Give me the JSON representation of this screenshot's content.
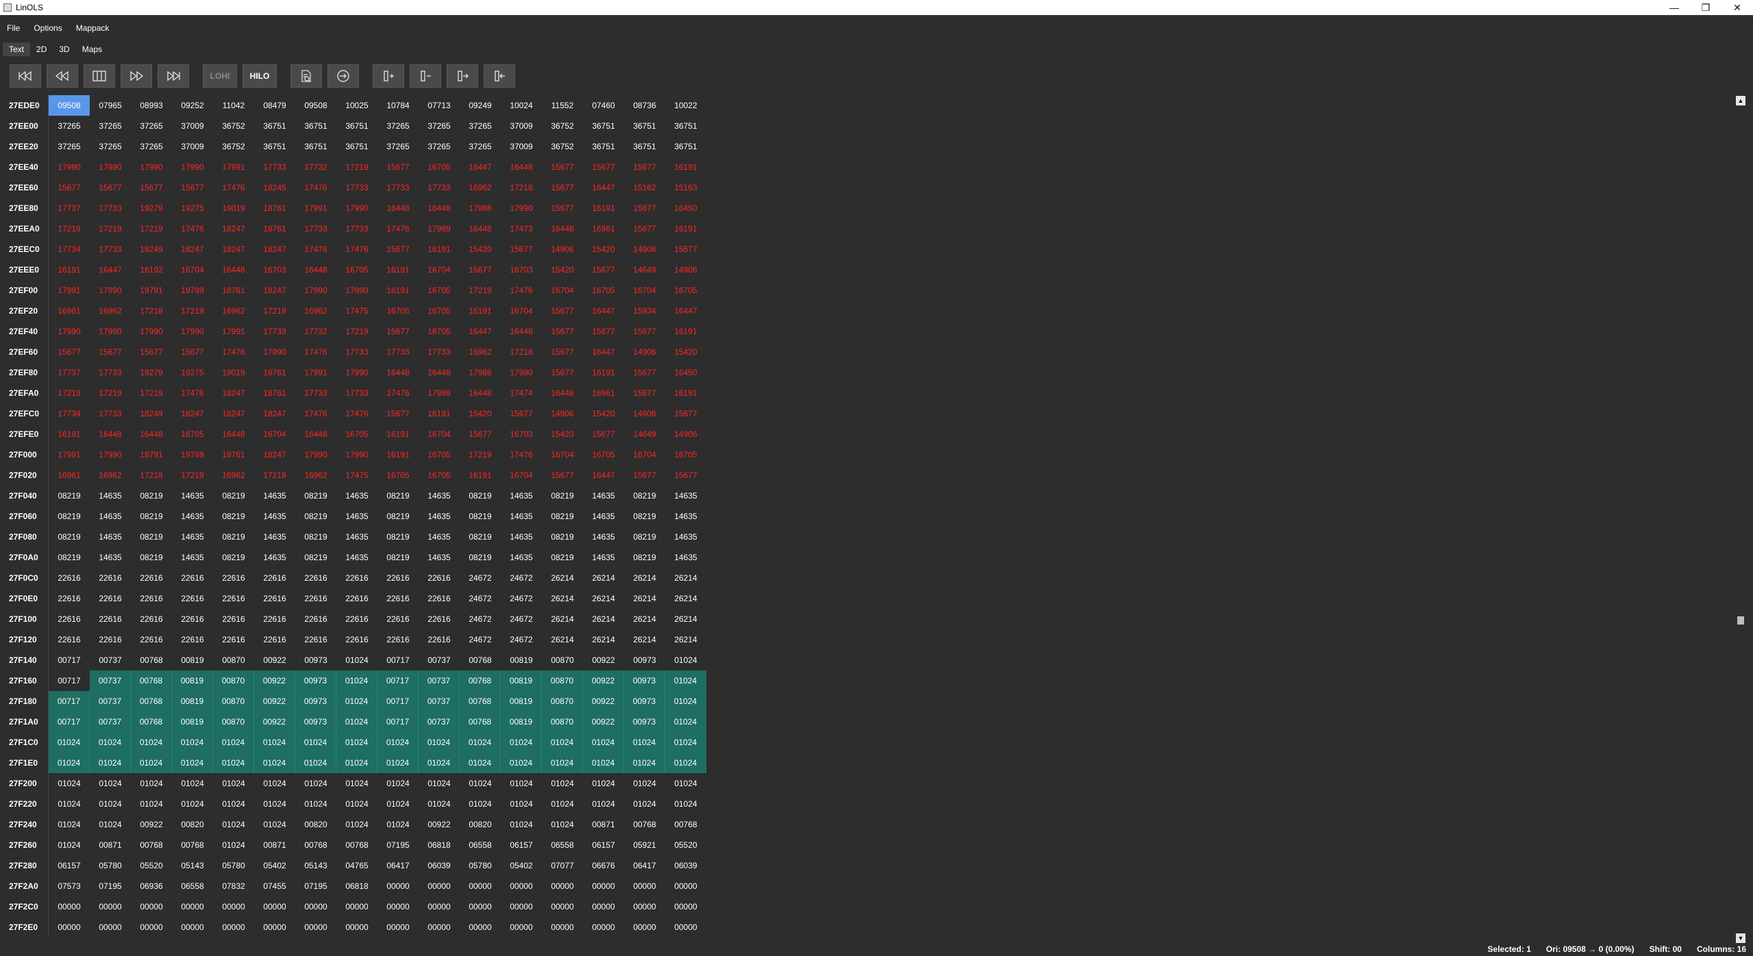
{
  "window": {
    "title": "LinOLS",
    "minimize": "—",
    "maximize": "❐",
    "close": "✕"
  },
  "menu": [
    "File",
    "Options",
    "Mappack"
  ],
  "view_tabs": [
    "Text",
    "2D",
    "3D",
    "Maps"
  ],
  "active_view": "Text",
  "toolbar": {
    "buttons": [
      {
        "name": "skip-first-button",
        "icon": "skip-first-icon"
      },
      {
        "name": "rewind-button",
        "icon": "rewind-icon"
      },
      {
        "name": "columns-button",
        "icon": "columns-icon"
      },
      {
        "name": "fast-forward-button",
        "icon": "fast-forward-icon"
      },
      {
        "name": "skip-last-button",
        "icon": "skip-last-icon"
      },
      {
        "name": "lohi-button",
        "label": "LOHI"
      },
      {
        "name": "hilo-button",
        "label": "HILO"
      },
      {
        "name": "find-document-button",
        "icon": "document-search-icon"
      },
      {
        "name": "goto-button",
        "icon": "goto-arrow-icon"
      },
      {
        "name": "add-column-right-button",
        "icon": "column-plus-icon"
      },
      {
        "name": "remove-column-button",
        "icon": "column-minus-icon"
      },
      {
        "name": "shift-right-button",
        "icon": "column-shift-right-icon"
      },
      {
        "name": "shift-left-button",
        "icon": "column-shift-left-icon"
      }
    ]
  },
  "hex_table": {
    "rows": [
      {
        "addr": "27EDE0",
        "vals": [
          "09508",
          "07965",
          "08993",
          "09252",
          "11042",
          "08479",
          "09508",
          "10025",
          "10784",
          "07713",
          "09249",
          "10024",
          "11552",
          "07460",
          "08736",
          "10022"
        ]
      },
      {
        "addr": "27EE00",
        "vals": [
          "37265",
          "37265",
          "37265",
          "37009",
          "36752",
          "36751",
          "36751",
          "36751",
          "37265",
          "37265",
          "37265",
          "37009",
          "36752",
          "36751",
          "36751",
          "36751"
        ]
      },
      {
        "addr": "27EE20",
        "vals": [
          "37265",
          "37265",
          "37265",
          "37009",
          "36752",
          "36751",
          "36751",
          "36751",
          "37265",
          "37265",
          "37265",
          "37009",
          "36752",
          "36751",
          "36751",
          "36751"
        ]
      },
      {
        "addr": "27EE40",
        "vals": [
          "17990",
          "17990",
          "17990",
          "17990",
          "17991",
          "17733",
          "17732",
          "17219",
          "15677",
          "16705",
          "16447",
          "16448",
          "15677",
          "15677",
          "15677",
          "16191"
        ]
      },
      {
        "addr": "27EE60",
        "vals": [
          "15677",
          "15677",
          "15677",
          "15677",
          "17476",
          "18245",
          "17476",
          "17733",
          "17733",
          "17733",
          "16962",
          "17218",
          "15677",
          "16447",
          "15162",
          "15163"
        ]
      },
      {
        "addr": "27EE80",
        "vals": [
          "17737",
          "17733",
          "19279",
          "19275",
          "19019",
          "18761",
          "17991",
          "17990",
          "16448",
          "16448",
          "17988",
          "17990",
          "15677",
          "16191",
          "15677",
          "16450"
        ]
      },
      {
        "addr": "27EEA0",
        "vals": [
          "17219",
          "17219",
          "17219",
          "17476",
          "18247",
          "18761",
          "17733",
          "17733",
          "17476",
          "17989",
          "16448",
          "17473",
          "16448",
          "16961",
          "15677",
          "16191"
        ]
      },
      {
        "addr": "27EEC0",
        "vals": [
          "17734",
          "17733",
          "18249",
          "18247",
          "18247",
          "18247",
          "17476",
          "17476",
          "15677",
          "16191",
          "15420",
          "15677",
          "14906",
          "15420",
          "14906",
          "15677"
        ]
      },
      {
        "addr": "27EEE0",
        "vals": [
          "16191",
          "16447",
          "16192",
          "16704",
          "16448",
          "16703",
          "16448",
          "16705",
          "16191",
          "16704",
          "15677",
          "16703",
          "15420",
          "15677",
          "14649",
          "14906"
        ]
      },
      {
        "addr": "27EF00",
        "vals": [
          "17991",
          "17990",
          "19791",
          "19789",
          "18761",
          "18247",
          "17990",
          "17990",
          "16191",
          "16705",
          "17219",
          "17476",
          "16704",
          "16705",
          "16704",
          "16705"
        ]
      },
      {
        "addr": "27EF20",
        "vals": [
          "16961",
          "16962",
          "17218",
          "17219",
          "16962",
          "17219",
          "16962",
          "17475",
          "16705",
          "16705",
          "16191",
          "16704",
          "15677",
          "16447",
          "15934",
          "16447"
        ]
      },
      {
        "addr": "27EF40",
        "vals": [
          "17990",
          "17990",
          "17990",
          "17990",
          "17991",
          "17733",
          "17732",
          "17219",
          "15677",
          "16705",
          "16447",
          "16448",
          "15677",
          "15677",
          "15677",
          "16191"
        ]
      },
      {
        "addr": "27EF60",
        "vals": [
          "15677",
          "15677",
          "15677",
          "15677",
          "17476",
          "17990",
          "17476",
          "17733",
          "17733",
          "17733",
          "16962",
          "17218",
          "15677",
          "16447",
          "14906",
          "15420"
        ]
      },
      {
        "addr": "27EF80",
        "vals": [
          "17737",
          "17733",
          "19279",
          "19275",
          "19019",
          "18761",
          "17991",
          "17990",
          "16448",
          "16448",
          "17988",
          "17990",
          "15677",
          "16191",
          "15677",
          "16450"
        ]
      },
      {
        "addr": "27EFA0",
        "vals": [
          "17219",
          "17219",
          "17219",
          "17476",
          "18247",
          "18761",
          "17733",
          "17733",
          "17476",
          "17989",
          "16448",
          "17474",
          "16448",
          "16961",
          "15677",
          "16191"
        ]
      },
      {
        "addr": "27EFC0",
        "vals": [
          "17734",
          "17733",
          "18249",
          "18247",
          "18247",
          "18247",
          "17476",
          "17476",
          "15677",
          "16191",
          "15420",
          "15677",
          "14906",
          "15420",
          "14906",
          "15677"
        ]
      },
      {
        "addr": "27EFE0",
        "vals": [
          "16191",
          "16448",
          "16448",
          "16705",
          "16448",
          "16704",
          "16448",
          "16705",
          "16191",
          "16704",
          "15677",
          "16703",
          "15420",
          "15677",
          "14649",
          "14906"
        ]
      },
      {
        "addr": "27F000",
        "vals": [
          "17991",
          "17990",
          "18791",
          "19789",
          "18761",
          "18247",
          "17990",
          "17990",
          "16191",
          "16705",
          "17219",
          "17476",
          "16704",
          "16705",
          "16704",
          "16705"
        ]
      },
      {
        "addr": "27F020",
        "vals": [
          "16961",
          "16962",
          "17218",
          "17219",
          "16962",
          "17219",
          "16962",
          "17475",
          "16705",
          "16705",
          "16191",
          "16704",
          "15677",
          "16447",
          "15677",
          "15677"
        ]
      },
      {
        "addr": "27F040",
        "vals": [
          "08219",
          "14635",
          "08219",
          "14635",
          "08219",
          "14635",
          "08219",
          "14635",
          "08219",
          "14635",
          "08219",
          "14635",
          "08219",
          "14635",
          "08219",
          "14635"
        ]
      },
      {
        "addr": "27F060",
        "vals": [
          "08219",
          "14635",
          "08219",
          "14635",
          "08219",
          "14635",
          "08219",
          "14635",
          "08219",
          "14635",
          "08219",
          "14635",
          "08219",
          "14635",
          "08219",
          "14635"
        ]
      },
      {
        "addr": "27F080",
        "vals": [
          "08219",
          "14635",
          "08219",
          "14635",
          "08219",
          "14635",
          "08219",
          "14635",
          "08219",
          "14635",
          "08219",
          "14635",
          "08219",
          "14635",
          "08219",
          "14635"
        ]
      },
      {
        "addr": "27F0A0",
        "vals": [
          "08219",
          "14635",
          "08219",
          "14635",
          "08219",
          "14635",
          "08219",
          "14635",
          "08219",
          "14635",
          "08219",
          "14635",
          "08219",
          "14635",
          "08219",
          "14635"
        ]
      },
      {
        "addr": "27F0C0",
        "vals": [
          "22616",
          "22616",
          "22616",
          "22616",
          "22616",
          "22616",
          "22616",
          "22616",
          "22616",
          "22616",
          "24672",
          "24672",
          "26214",
          "26214",
          "26214",
          "26214"
        ]
      },
      {
        "addr": "27F0E0",
        "vals": [
          "22616",
          "22616",
          "22616",
          "22616",
          "22616",
          "22616",
          "22616",
          "22616",
          "22616",
          "22616",
          "24672",
          "24672",
          "26214",
          "26214",
          "26214",
          "26214"
        ]
      },
      {
        "addr": "27F100",
        "vals": [
          "22616",
          "22616",
          "22616",
          "22616",
          "22616",
          "22616",
          "22616",
          "22616",
          "22616",
          "22616",
          "24672",
          "24672",
          "26214",
          "26214",
          "26214",
          "26214"
        ]
      },
      {
        "addr": "27F120",
        "vals": [
          "22616",
          "22616",
          "22616",
          "22616",
          "22616",
          "22616",
          "22616",
          "22616",
          "22616",
          "22616",
          "24672",
          "24672",
          "26214",
          "26214",
          "26214",
          "26214"
        ]
      },
      {
        "addr": "27F140",
        "vals": [
          "00717",
          "00737",
          "00768",
          "00819",
          "00870",
          "00922",
          "00973",
          "01024",
          "00717",
          "00737",
          "00768",
          "00819",
          "00870",
          "00922",
          "00973",
          "01024"
        ]
      },
      {
        "addr": "27F160",
        "vals": [
          "00717",
          "00737",
          "00768",
          "00819",
          "00870",
          "00922",
          "00973",
          "01024",
          "00717",
          "00737",
          "00768",
          "00819",
          "00870",
          "00922",
          "00973",
          "01024"
        ]
      },
      {
        "addr": "27F180",
        "vals": [
          "00717",
          "00737",
          "00768",
          "00819",
          "00870",
          "00922",
          "00973",
          "01024",
          "00717",
          "00737",
          "00768",
          "00819",
          "00870",
          "00922",
          "00973",
          "01024"
        ]
      },
      {
        "addr": "27F1A0",
        "vals": [
          "00717",
          "00737",
          "00768",
          "00819",
          "00870",
          "00922",
          "00973",
          "01024",
          "00717",
          "00737",
          "00768",
          "00819",
          "00870",
          "00922",
          "00973",
          "01024"
        ]
      },
      {
        "addr": "27F1C0",
        "vals": [
          "01024",
          "01024",
          "01024",
          "01024",
          "01024",
          "01024",
          "01024",
          "01024",
          "01024",
          "01024",
          "01024",
          "01024",
          "01024",
          "01024",
          "01024",
          "01024"
        ]
      },
      {
        "addr": "27F1E0",
        "vals": [
          "01024",
          "01024",
          "01024",
          "01024",
          "01024",
          "01024",
          "01024",
          "01024",
          "01024",
          "01024",
          "01024",
          "01024",
          "01024",
          "01024",
          "01024",
          "01024"
        ]
      },
      {
        "addr": "27F200",
        "vals": [
          "01024",
          "01024",
          "01024",
          "01024",
          "01024",
          "01024",
          "01024",
          "01024",
          "01024",
          "01024",
          "01024",
          "01024",
          "01024",
          "01024",
          "01024",
          "01024"
        ]
      },
      {
        "addr": "27F220",
        "vals": [
          "01024",
          "01024",
          "01024",
          "01024",
          "01024",
          "01024",
          "01024",
          "01024",
          "01024",
          "01024",
          "01024",
          "01024",
          "01024",
          "01024",
          "01024",
          "01024"
        ]
      },
      {
        "addr": "27F240",
        "vals": [
          "01024",
          "01024",
          "00922",
          "00820",
          "01024",
          "01024",
          "00820",
          "01024",
          "01024",
          "00922",
          "00820",
          "01024",
          "01024",
          "00871",
          "00768",
          "00768"
        ]
      },
      {
        "addr": "27F260",
        "vals": [
          "01024",
          "00871",
          "00768",
          "00768",
          "01024",
          "00871",
          "00768",
          "00768",
          "07195",
          "06818",
          "06558",
          "06157",
          "06558",
          "06157",
          "05921",
          "05520"
        ]
      },
      {
        "addr": "27F280",
        "vals": [
          "06157",
          "05780",
          "05520",
          "05143",
          "05780",
          "05402",
          "05143",
          "04765",
          "06417",
          "06039",
          "05780",
          "05402",
          "07077",
          "06676",
          "06417",
          "06039"
        ]
      },
      {
        "addr": "27F2A0",
        "vals": [
          "07573",
          "07195",
          "06936",
          "06558",
          "07832",
          "07455",
          "07195",
          "06818",
          "00000",
          "00000",
          "00000",
          "00000",
          "00000",
          "00000",
          "00000",
          "00000"
        ]
      },
      {
        "addr": "27F2C0",
        "vals": [
          "00000",
          "00000",
          "00000",
          "00000",
          "00000",
          "00000",
          "00000",
          "00000",
          "00000",
          "00000",
          "00000",
          "00000",
          "00000",
          "00000",
          "00000",
          "00000"
        ]
      },
      {
        "addr": "27F2E0",
        "vals": [
          "00000",
          "00000",
          "00000",
          "00000",
          "00000",
          "00000",
          "00000",
          "00000",
          "00000",
          "00000",
          "00000",
          "00000",
          "00000",
          "00000",
          "00000",
          "00000"
        ]
      }
    ],
    "red_rows": [
      3,
      18
    ],
    "teal_selection": {
      "first_row": 28,
      "last_row": 32,
      "first_col_row": 28,
      "tail_row": 32,
      "tail_cols": 1
    },
    "cursor_cell": {
      "row": 0,
      "col": 0
    },
    "colors": {
      "red_text": "#ff2525",
      "teal_fill": "#1e6e62",
      "cursor_fill": "#5897e8"
    }
  },
  "status": {
    "selected": "Selected: 1",
    "ori": "Ori: 09508 → 0 (0.00%)",
    "shift": "Shift: 00",
    "columns": "Columns: 16"
  }
}
